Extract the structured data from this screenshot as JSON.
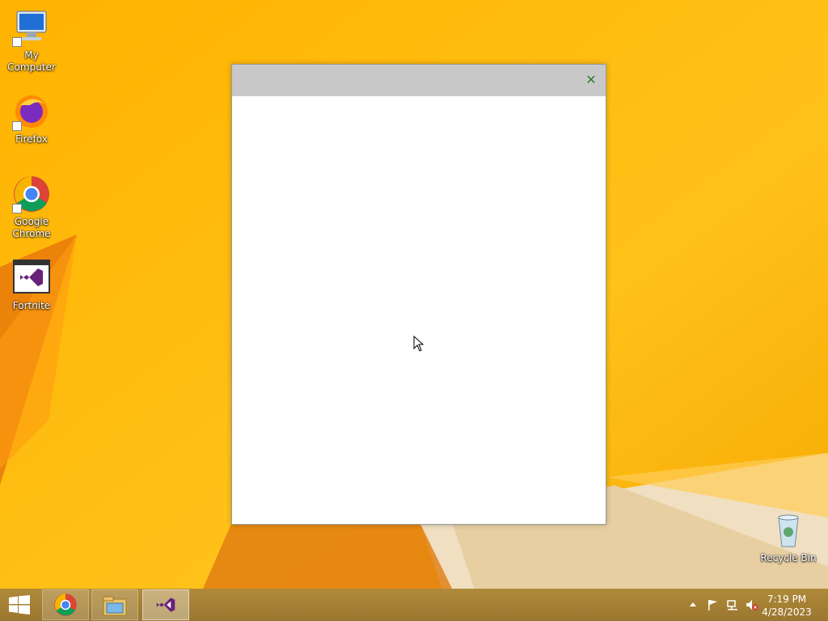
{
  "desktop": {
    "icons": [
      {
        "label": "My Computer",
        "icon": "computer-icon"
      },
      {
        "label": "Firefox",
        "icon": "firefox-icon"
      },
      {
        "label": "Google Chrome",
        "icon": "chrome-icon"
      },
      {
        "label": "Fortnite",
        "icon": "visual-studio-icon"
      },
      {
        "label": "Recycle Bin",
        "icon": "recycle-bin-icon"
      }
    ]
  },
  "dialog": {
    "close_label": "✕"
  },
  "taskbar": {
    "start_icon": "windows-logo-icon",
    "pinned": [
      {
        "name": "Google Chrome",
        "icon": "chrome-icon"
      },
      {
        "name": "File Explorer",
        "icon": "folder-icon"
      },
      {
        "name": "Visual Studio",
        "icon": "visual-studio-icon"
      }
    ],
    "tray_icons": [
      "show-hidden-icons-chevron",
      "action-center-flag-icon",
      "network-icon",
      "volume-muted-icon"
    ],
    "clock": {
      "time": "7:19 PM",
      "date": "4/28/2023"
    }
  },
  "colors": {
    "accent": "#f5b400",
    "dialog_titlebar": "#c8c8c8",
    "close_glyph": "#2e7d32",
    "taskbar": "#a8843a"
  }
}
